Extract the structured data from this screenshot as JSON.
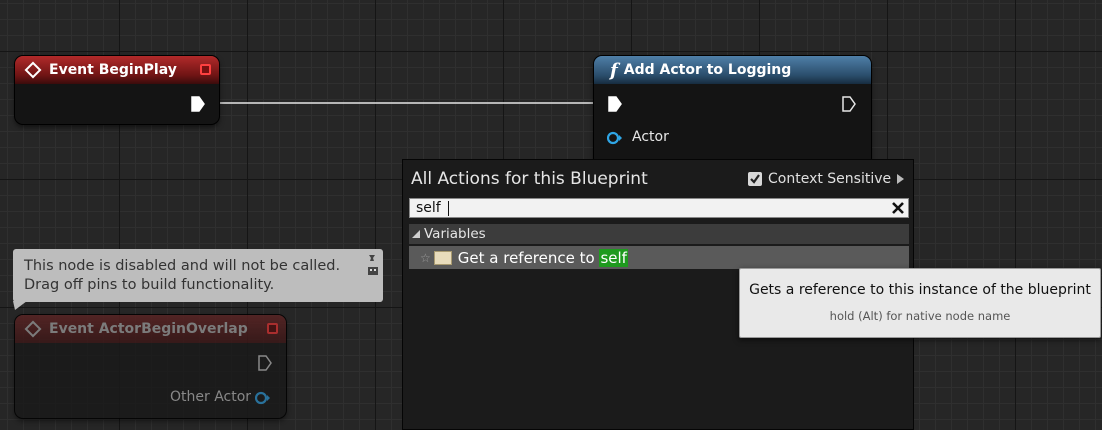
{
  "nodes": {
    "begin_play": {
      "title": "Event BeginPlay"
    },
    "add_actor": {
      "title": "Add Actor to Logging",
      "function_glyph": "f",
      "pin_actor": "Actor"
    },
    "begin_overlap": {
      "title": "Event ActorBeginOverlap",
      "pin_other_actor": "Other Actor"
    }
  },
  "comment": {
    "line1": "This node is disabled and will not be called.",
    "line2": "Drag off pins to build functionality."
  },
  "context_menu": {
    "title": "All Actions for this Blueprint",
    "context_sensitive_label": "Context Sensitive",
    "context_sensitive_checked": true,
    "search_value": "self",
    "category": "Variables",
    "result_prefix": "Get a reference to ",
    "result_highlight": "self"
  },
  "tooltip": {
    "title": "Gets a reference to this instance of the blueprint",
    "hint": "hold (Alt) for native node name"
  },
  "colors": {
    "event_header": "#8b1e1e",
    "function_header": "#3a6386",
    "object_pin": "#2fa6e6",
    "search_highlight": "#1f9a1f"
  }
}
